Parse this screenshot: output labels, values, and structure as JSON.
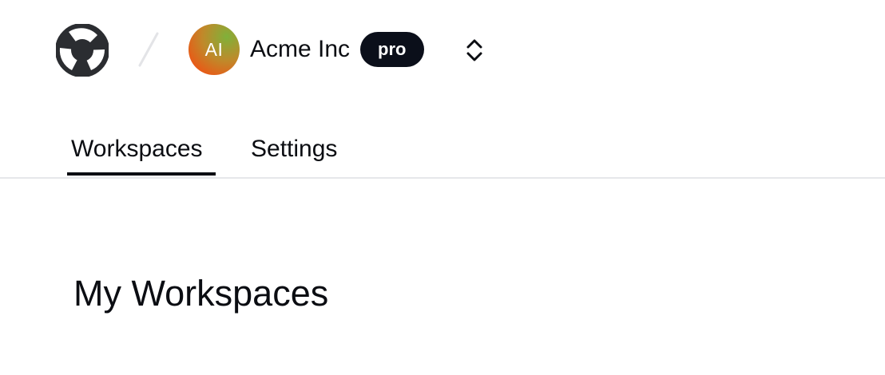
{
  "header": {
    "org": {
      "avatar_initials": "AI",
      "name": "Acme Inc",
      "plan_badge": "pro"
    }
  },
  "tabs": [
    {
      "label": "Workspaces",
      "active": true
    },
    {
      "label": "Settings",
      "active": false
    }
  ],
  "main": {
    "title": "My Workspaces"
  },
  "colors": {
    "text": "#0b0d12",
    "badge_bg": "#0b0f1a",
    "divider": "#e6e7ea",
    "avatar_gradient": [
      "#7fb13a",
      "#c0892a",
      "#e85a17"
    ]
  },
  "icons": {
    "logo": "app-logo-icon",
    "separator": "slash-separator-icon",
    "switcher": "chevron-up-down-icon"
  }
}
